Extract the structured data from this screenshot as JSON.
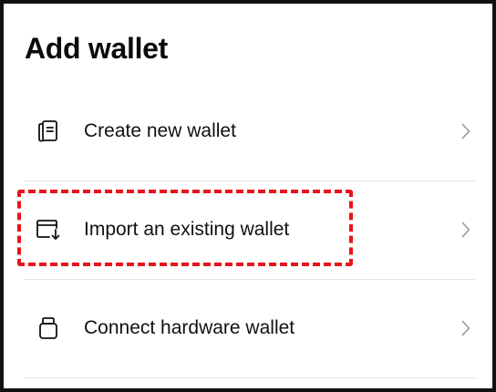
{
  "header": {
    "title": "Add wallet"
  },
  "options": [
    {
      "label": "Create new wallet",
      "icon": "wallet-document-icon"
    },
    {
      "label": "Import an existing wallet",
      "icon": "wallet-import-icon"
    },
    {
      "label": "Connect hardware wallet",
      "icon": "hardware-wallet-icon"
    }
  ],
  "colors": {
    "highlight": "#e8141b",
    "text": "#111111",
    "chevron": "#9a9a9a",
    "divider": "#e6e6e6"
  }
}
